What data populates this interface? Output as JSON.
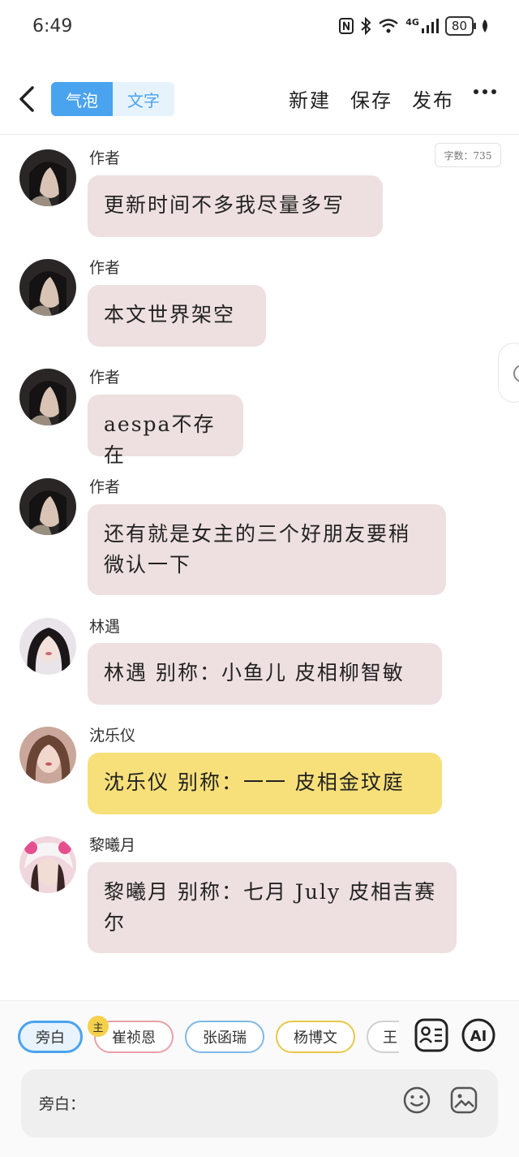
{
  "status": {
    "time": "6:49",
    "battery": "80",
    "network": "4G"
  },
  "header": {
    "tab_bubble": "气泡",
    "tab_text": "文字",
    "new_label": "新建",
    "save_label": "保存",
    "publish_label": "发布"
  },
  "word_count": "字数：735",
  "messages": [
    {
      "name": "作者",
      "text": "更新时间不多我尽量多写"
    },
    {
      "name": "作者",
      "text": "本文世界架空"
    },
    {
      "name": "作者",
      "text": "aespa不存在"
    },
    {
      "name": "作者",
      "text": "还有就是女主的三个好朋友要稍微认一下"
    },
    {
      "name": "林遇",
      "text": "林遇 别称：小鱼儿 皮相柳智敏"
    },
    {
      "name": "沈乐仪",
      "text": "沈乐仪 别称：一一 皮相金玟庭"
    },
    {
      "name": "黎曦月",
      "text": "黎曦月 别称：七月 July 皮相吉赛尔"
    }
  ],
  "characters": [
    {
      "label": "旁白",
      "color": "#4aa3ee"
    },
    {
      "label": "崔祯恩",
      "color": "#e8a0a8",
      "badge": "主"
    },
    {
      "label": "张函瑞",
      "color": "#7fb8e6"
    },
    {
      "label": "杨博文",
      "color": "#e9c84a"
    },
    {
      "label": "王",
      "color": "#d0d0d0"
    }
  ],
  "input": {
    "prefix": "旁白："
  },
  "icons": [
    "back-icon",
    "contact-card-icon",
    "ai-icon",
    "emoji-icon",
    "image-icon"
  ]
}
